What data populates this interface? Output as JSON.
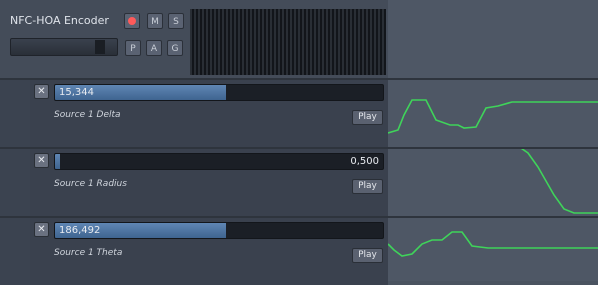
{
  "track": {
    "name": "NFC-HOA Encoder",
    "buttons": {
      "mute": "M",
      "solo": "S",
      "p": "P",
      "a": "A",
      "g": "G"
    }
  },
  "lanes": [
    {
      "value": "15,344",
      "fill_fraction": 0.52,
      "value_align": "left",
      "name": "Source 1 Delta",
      "play": "Play"
    },
    {
      "value": "0,500",
      "fill_fraction": 0.015,
      "value_align": "right",
      "name": "Source 1 Radius",
      "play": "Play"
    },
    {
      "value": "186,492",
      "fill_fraction": 0.52,
      "value_align": "left",
      "name": "Source 1 Theta",
      "play": "Play"
    }
  ],
  "close_label": "✕"
}
